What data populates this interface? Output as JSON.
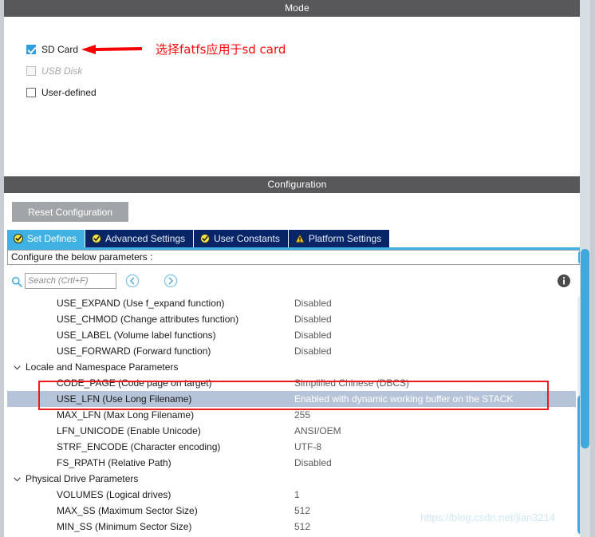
{
  "mode": {
    "title": "Mode",
    "options": [
      {
        "label": "SD Card",
        "checked": true,
        "disabled": false
      },
      {
        "label": "USB Disk",
        "checked": false,
        "disabled": true
      },
      {
        "label": "User-defined",
        "checked": false,
        "disabled": false
      }
    ],
    "annotation": "选择fatfs应用于sd card",
    "annotation_color": "#fb0b0b"
  },
  "configuration": {
    "title": "Configuration",
    "reset_label": "Reset Configuration",
    "tabs": [
      {
        "label": "Set Defines",
        "icon": "check-circle-icon",
        "active": true
      },
      {
        "label": "Advanced Settings",
        "icon": "check-circle-icon",
        "active": false
      },
      {
        "label": "User Constants",
        "icon": "check-circle-icon",
        "active": false
      },
      {
        "label": "Platform Settings",
        "icon": "warning-triangle-icon",
        "active": false
      }
    ],
    "configure_text": "Configure the below parameters :",
    "search": {
      "placeholder": "Search (Crtl+F)",
      "value": "",
      "icon": "search-icon",
      "prev_icon": "circle-left-arrow-icon",
      "next_icon": "circle-right-arrow-icon",
      "info_icon": "info-icon"
    },
    "rows": [
      {
        "type": "param",
        "name": "USE_EXPAND (Use f_expand function)",
        "value": "Disabled",
        "selected": false
      },
      {
        "type": "param",
        "name": "USE_CHMOD (Change attributes function)",
        "value": "Disabled",
        "selected": false
      },
      {
        "type": "param",
        "name": "USE_LABEL (Volume label functions)",
        "value": "Disabled",
        "selected": false
      },
      {
        "type": "param",
        "name": "USE_FORWARD (Forward function)",
        "value": "Disabled",
        "selected": false
      },
      {
        "type": "group",
        "name": "Locale and Namespace Parameters",
        "value": "",
        "selected": false
      },
      {
        "type": "param",
        "name": "CODE_PAGE (Code page on target)",
        "value": "Simplified Chinese (DBCS)",
        "selected": false
      },
      {
        "type": "param",
        "name": "USE_LFN (Use Long Filename)",
        "value": "Enabled with dynamic working buffer on the STACK",
        "selected": true
      },
      {
        "type": "param",
        "name": "MAX_LFN (Max Long Filename)",
        "value": "255",
        "selected": false
      },
      {
        "type": "param",
        "name": "LFN_UNICODE (Enable Unicode)",
        "value": "ANSI/OEM",
        "selected": false
      },
      {
        "type": "param",
        "name": "STRF_ENCODE (Character encoding)",
        "value": "UTF-8",
        "selected": false
      },
      {
        "type": "param",
        "name": "FS_RPATH (Relative Path)",
        "value": "Disabled",
        "selected": false
      },
      {
        "type": "group",
        "name": "Physical Drive Parameters",
        "value": "",
        "selected": false
      },
      {
        "type": "param",
        "name": "VOLUMES (Logical drives)",
        "value": "1",
        "selected": false
      },
      {
        "type": "param",
        "name": "MAX_SS (Maximum Sector Size)",
        "value": "512",
        "selected": false
      },
      {
        "type": "param",
        "name": "MIN_SS (Minimum Sector Size)",
        "value": "512",
        "selected": false
      }
    ]
  },
  "watermark": "https://blog.csdn.net/jian3214",
  "colors": {
    "header_bar": "#58585a",
    "tab_active": "#3fb2e3",
    "tab_inactive": "#082567",
    "accent_blue": "#3fa9dd",
    "selection": "#b6c4d9",
    "annotation_red": "#ee1c1c",
    "button_grey": "#a1a5a8"
  }
}
